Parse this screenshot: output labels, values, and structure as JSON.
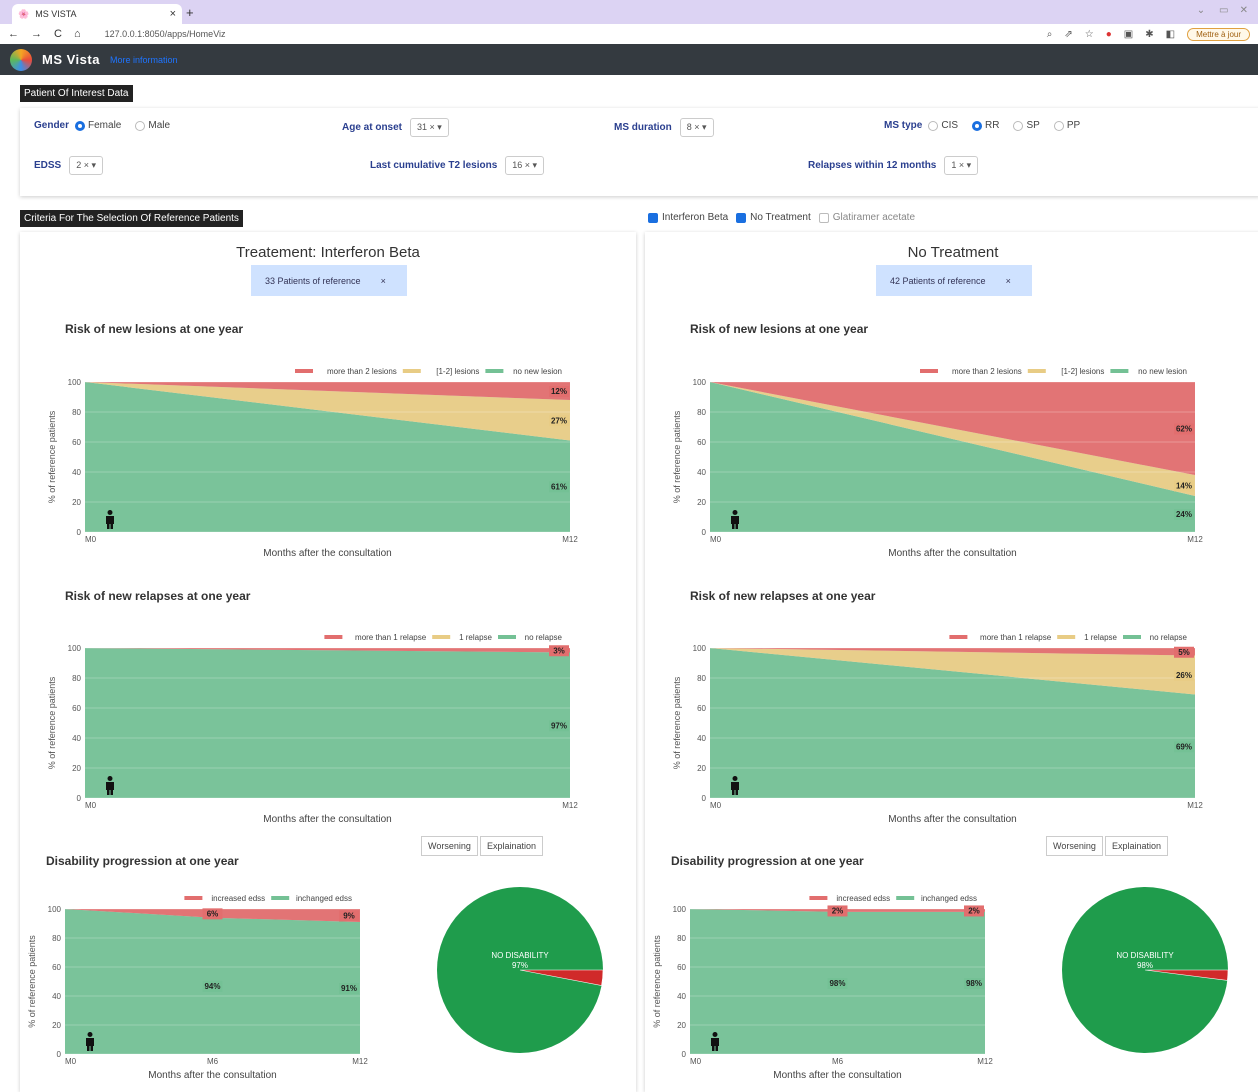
{
  "browser": {
    "tab_title": "MS VISTA",
    "url": "127.0.0.1:8050/apps/HomeViz",
    "update_label": "Mettre à jour"
  },
  "app": {
    "brand": "MS Vista",
    "more_info": "More information"
  },
  "poi": {
    "header": "Patient Of Interest Data",
    "gender_label": "Gender",
    "gender_options": [
      "Female",
      "Male"
    ],
    "gender_selected": "Female",
    "age_label": "Age at onset",
    "age_value": "31",
    "duration_label": "MS duration",
    "duration_value": "8",
    "mstype_label": "MS type",
    "mstype_options": [
      "CIS",
      "RR",
      "SP",
      "PP"
    ],
    "mstype_selected": "RR",
    "edss_label": "EDSS",
    "edss_value": "2",
    "t2_label": "Last cumulative T2 lesions",
    "t2_value": "16",
    "relapses_label": "Relapses within 12 months",
    "relapses_value": "1"
  },
  "criteria": {
    "header": "Criteria For The Selection Of Reference Patients",
    "treatments": [
      {
        "label": "Interferon Beta",
        "checked": true
      },
      {
        "label": "No Treatment",
        "checked": true
      },
      {
        "label": "Glatiramer acetate",
        "checked": false
      }
    ]
  },
  "common": {
    "xlabel": "Months after the consultation",
    "ylabel": "% of reference patients",
    "worsening": "Worsening",
    "explanation": "Explaination",
    "no_disability": "NO DISABILITY"
  },
  "colors": {
    "red": "#e26e6e",
    "yellow": "#e8cc85",
    "green": "#74c195",
    "pie_green": "#1f9c4c",
    "pie_red": "#d02a2a"
  },
  "panels": [
    {
      "title": "Treatement: Interferon Beta",
      "patients": "33 Patients of reference",
      "chart_data": [
        {
          "type": "area",
          "title": "Risk of new lesions at one year",
          "x": [
            "M0",
            "M12"
          ],
          "ylim": [
            0,
            100
          ],
          "series": [
            {
              "name": "more than 2 lesions",
              "values": [
                0,
                12
              ],
              "label": "12%"
            },
            {
              "name": "[1-2] lesions",
              "values": [
                0,
                27
              ],
              "label": "27%"
            },
            {
              "name": "no new lesion",
              "values": [
                100,
                61
              ],
              "label": "61%"
            }
          ]
        },
        {
          "type": "area",
          "title": "Risk of new relapses at one year",
          "x": [
            "M0",
            "M12"
          ],
          "ylim": [
            0,
            100
          ],
          "series": [
            {
              "name": "more than 1 relapse",
              "values": [
                0,
                3
              ],
              "label": "3%"
            },
            {
              "name": "1 relapse",
              "values": [
                0,
                0
              ]
            },
            {
              "name": "no relapse",
              "values": [
                100,
                97
              ],
              "label": "97%"
            }
          ]
        },
        {
          "type": "area",
          "title": "Disability progression at one year",
          "x": [
            "M0",
            "M6",
            "M12"
          ],
          "ylim": [
            0,
            100
          ],
          "series": [
            {
              "name": "increased edss",
              "values": [
                0,
                6,
                9
              ],
              "labels": [
                "",
                "6%",
                "9%"
              ]
            },
            {
              "name": "inchanged edss",
              "values": [
                100,
                94,
                91
              ],
              "labels": [
                "",
                "94%",
                "91%"
              ]
            }
          ]
        },
        {
          "type": "pie",
          "values": [
            97,
            3
          ],
          "labels": [
            "NO DISABILITY",
            "97%"
          ]
        }
      ]
    },
    {
      "title": "No Treatment",
      "patients": "42 Patients of reference",
      "chart_data": [
        {
          "type": "area",
          "title": "Risk of new lesions at one year",
          "x": [
            "M0",
            "M12"
          ],
          "ylim": [
            0,
            100
          ],
          "series": [
            {
              "name": "more than 2 lesions",
              "values": [
                0,
                62
              ],
              "label": "62%"
            },
            {
              "name": "[1-2] lesions",
              "values": [
                0,
                14
              ],
              "label": "14%"
            },
            {
              "name": "no new lesion",
              "values": [
                100,
                24
              ],
              "label": "24%"
            }
          ]
        },
        {
          "type": "area",
          "title": "Risk of new relapses at one year",
          "x": [
            "M0",
            "M12"
          ],
          "ylim": [
            0,
            100
          ],
          "series": [
            {
              "name": "more than 1 relapse",
              "values": [
                0,
                5
              ],
              "label": "5%"
            },
            {
              "name": "1 relapse",
              "values": [
                0,
                26
              ],
              "label": "26%"
            },
            {
              "name": "no relapse",
              "values": [
                100,
                69
              ],
              "label": "69%"
            }
          ]
        },
        {
          "type": "area",
          "title": "Disability progression at one year",
          "x": [
            "M0",
            "M6",
            "M12"
          ],
          "ylim": [
            0,
            100
          ],
          "series": [
            {
              "name": "increased edss",
              "values": [
                0,
                2,
                2
              ],
              "labels": [
                "",
                "2%",
                "2%"
              ]
            },
            {
              "name": "inchanged edss",
              "values": [
                100,
                98,
                98
              ],
              "labels": [
                "",
                "98%",
                "98%"
              ]
            }
          ]
        },
        {
          "type": "pie",
          "values": [
            98,
            2
          ],
          "labels": [
            "NO DISABILITY",
            "98%"
          ]
        }
      ]
    }
  ]
}
